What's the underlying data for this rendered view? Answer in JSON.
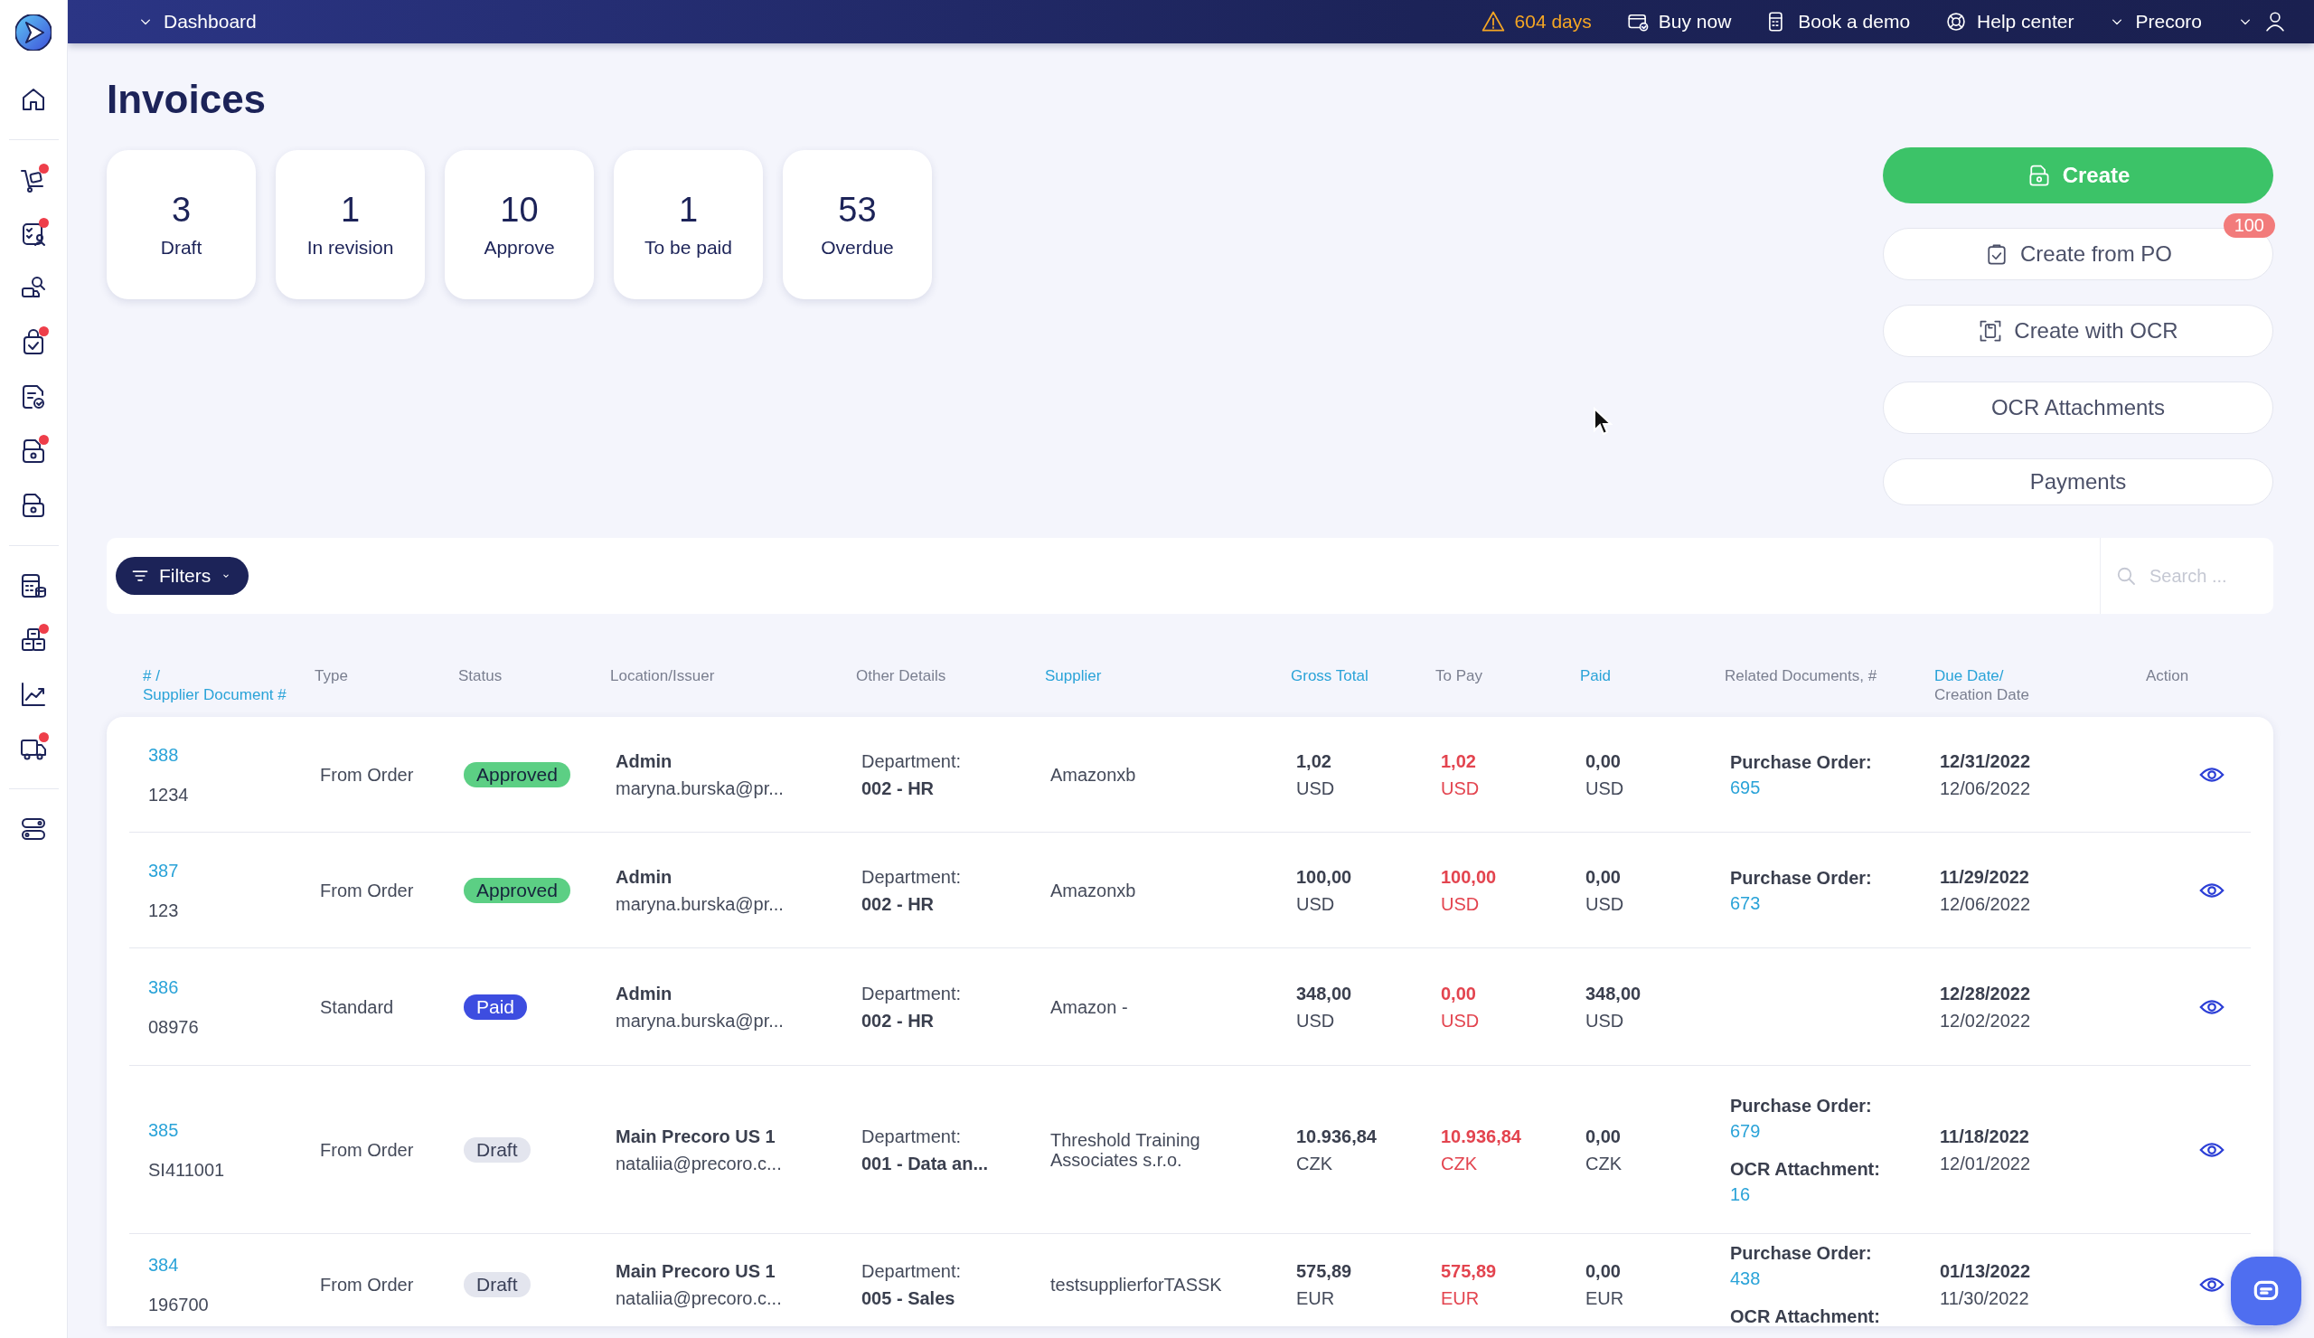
{
  "sidebar": {
    "groups": [
      [
        {
          "badge": false
        }
      ],
      [
        {
          "badge": true
        },
        {
          "badge": true
        },
        {
          "badge": false
        },
        {
          "badge": true
        },
        {
          "badge": false
        },
        {
          "badge": true
        },
        {
          "badge": false
        }
      ],
      [
        {
          "badge": false
        },
        {
          "badge": true
        },
        {
          "badge": false
        },
        {
          "badge": true
        }
      ],
      [
        {
          "badge": false
        }
      ]
    ]
  },
  "top_bar": {
    "breadcrumb": "Dashboard",
    "trial": "604 days",
    "links": [
      "Buy now",
      "Book a demo",
      "Help center"
    ],
    "company": "Precoro"
  },
  "page_title": "Invoices",
  "stats": [
    {
      "count": "3",
      "label": "Draft"
    },
    {
      "count": "1",
      "label": "In revision"
    },
    {
      "count": "10",
      "label": "Approve"
    },
    {
      "count": "1",
      "label": "To be paid"
    },
    {
      "count": "53",
      "label": "Overdue"
    }
  ],
  "actions": {
    "create": "Create",
    "buttons": [
      {
        "label": "Create from PO",
        "badge": "100"
      },
      {
        "label": "Create with OCR"
      },
      {
        "label": "OCR Attachments"
      },
      {
        "label": "Payments"
      }
    ]
  },
  "filters": {
    "button": "Filters",
    "search_placeholder": "Search ..."
  },
  "table": {
    "columns": [
      {
        "lines": [
          {
            "text": "# /",
            "sortable": true
          },
          {
            "text": "Supplier Document #",
            "sortable": true
          }
        ]
      },
      {
        "lines": [
          {
            "text": "Type",
            "sortable": false
          }
        ]
      },
      {
        "lines": [
          {
            "text": "Status",
            "sortable": false
          }
        ]
      },
      {
        "lines": [
          {
            "text": "Location/Issuer",
            "sortable": false
          }
        ]
      },
      {
        "lines": [
          {
            "text": "Other Details",
            "sortable": false
          }
        ]
      },
      {
        "lines": [
          {
            "text": "Supplier",
            "sortable": true
          }
        ]
      },
      {
        "lines": [
          {
            "text": "Gross Total",
            "sortable": true
          }
        ]
      },
      {
        "lines": [
          {
            "text": "To Pay",
            "sortable": false
          }
        ]
      },
      {
        "lines": [
          {
            "text": "Paid",
            "sortable": true
          }
        ]
      },
      {
        "lines": [
          {
            "text": "Related Documents, #",
            "sortable": false
          }
        ]
      },
      {
        "lines": [
          {
            "text": "Due Date/",
            "sortable": true
          },
          {
            "text": "Creation Date",
            "sortable": false
          }
        ]
      },
      {
        "lines": [
          {
            "text": "Action",
            "sortable": false
          }
        ]
      }
    ],
    "rows": [
      {
        "number": "388",
        "document": "1234",
        "type": "From Order",
        "status": {
          "label": "Approved",
          "kind": "approved"
        },
        "issuer": "Admin",
        "email": "maryna.burska@pr...",
        "detail_label": "Department:",
        "detail_value": "002 - HR",
        "supplier": "Amazonxb",
        "gross": [
          "1,02",
          "USD"
        ],
        "to_pay": [
          "1,02",
          "USD"
        ],
        "paid": [
          "0,00",
          "USD"
        ],
        "related": [
          {
            "label": "Purchase Order:",
            "number": "695"
          }
        ],
        "due": "12/31/2022",
        "created": "12/06/2022"
      },
      {
        "number": "387",
        "document": "123",
        "type": "From Order",
        "status": {
          "label": "Approved",
          "kind": "approved"
        },
        "issuer": "Admin",
        "email": "maryna.burska@pr...",
        "detail_label": "Department:",
        "detail_value": "002 - HR",
        "supplier": "Amazonxb",
        "gross": [
          "100,00",
          "USD"
        ],
        "to_pay": [
          "100,00",
          "USD"
        ],
        "paid": [
          "0,00",
          "USD"
        ],
        "related": [
          {
            "label": "Purchase Order:",
            "number": "673"
          }
        ],
        "due": "11/29/2022",
        "created": "12/06/2022"
      },
      {
        "number": "386",
        "document": "08976",
        "type": "Standard",
        "status": {
          "label": "Paid",
          "kind": "paid"
        },
        "issuer": "Admin",
        "email": "maryna.burska@pr...",
        "detail_label": "Department:",
        "detail_value": "002 - HR",
        "supplier": "Amazon -",
        "gross": [
          "348,00",
          "USD"
        ],
        "to_pay": [
          "0,00",
          "USD"
        ],
        "paid": [
          "348,00",
          "USD"
        ],
        "due": "12/28/2022",
        "created": "12/02/2022"
      },
      {
        "number": "385",
        "document": "SI411001",
        "type": "From Order",
        "status": {
          "label": "Draft",
          "kind": "draft"
        },
        "issuer": "Main Precoro US 1",
        "email": "nataliia@precoro.c...",
        "detail_label": "Department:",
        "detail_value": "001 - Data an...",
        "supplier": "Threshold Training Associates s.r.o.",
        "gross": [
          "10.936,84",
          "CZK"
        ],
        "to_pay": [
          "10.936,84",
          "CZK"
        ],
        "paid": [
          "0,00",
          "CZK"
        ],
        "related": [
          {
            "label": "Purchase Order:",
            "number": "679"
          },
          {
            "label": "OCR Attachment:",
            "number": "16"
          }
        ],
        "due": "11/18/2022",
        "created": "12/01/2022"
      },
      {
        "number": "384",
        "document": "196700",
        "type": "From Order",
        "status": {
          "label": "Draft",
          "kind": "draft"
        },
        "issuer": "Main Precoro US 1",
        "email": "nataliia@precoro.c...",
        "detail_label": "Department:",
        "detail_value": "005 - Sales",
        "supplier": "testsupplierforTASSK",
        "gross": [
          "575,89",
          "EUR"
        ],
        "to_pay": [
          "575,89",
          "EUR"
        ],
        "paid": [
          "0,00",
          "EUR"
        ],
        "related": [
          {
            "label": "Purchase Order:",
            "number": "438"
          },
          {
            "label": "OCR Attachment:"
          }
        ],
        "due": "01/13/2022",
        "created": "11/30/2022"
      }
    ]
  }
}
